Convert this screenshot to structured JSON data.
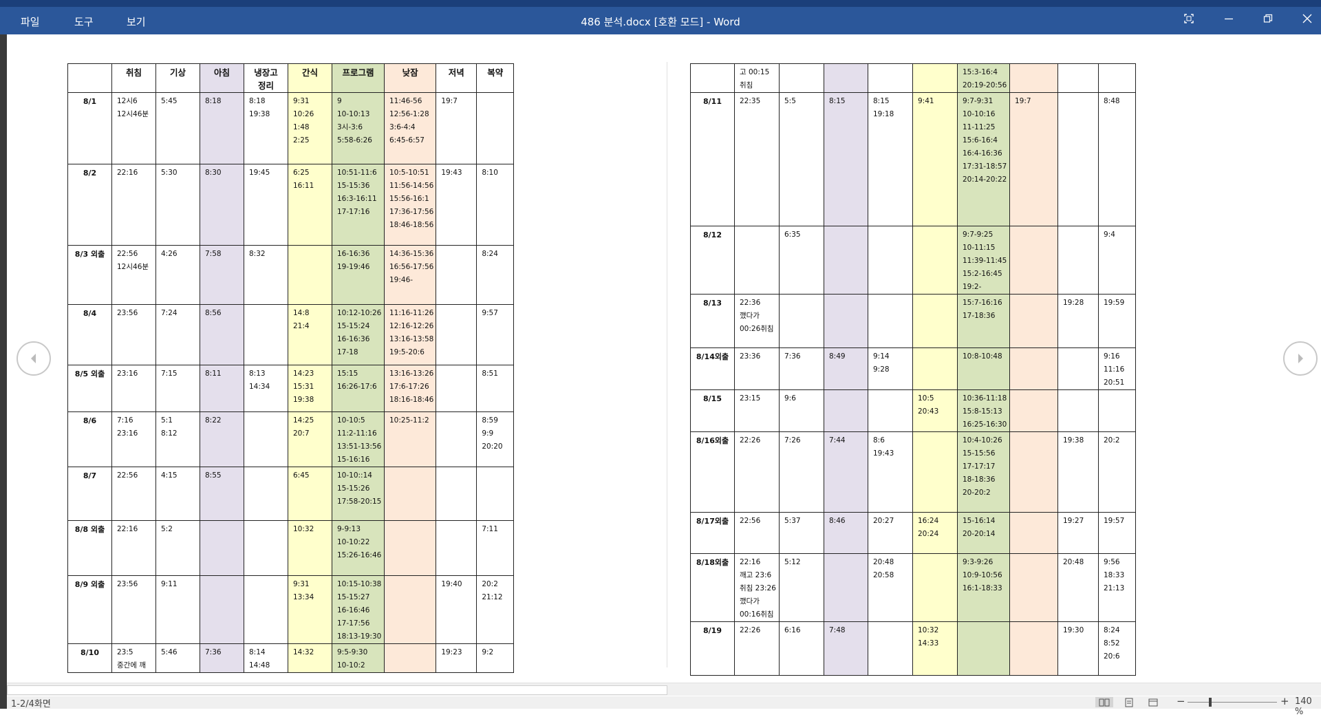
{
  "window": {
    "title": "486 분석.docx [호환 모드] - Word",
    "menus": [
      "파일",
      "도구",
      "보기"
    ]
  },
  "table": {
    "headers": [
      "",
      "취침",
      "기상",
      "아침",
      "냉장고\n정리",
      "간식",
      "프로그램",
      "낮잠",
      "저녁",
      "복약"
    ],
    "page1": [
      {
        "date": "8/1",
        "cells": [
          "12시6\n12시46분",
          "5:45",
          "8:18",
          "8:18\n19:38",
          "9:31\n10:26\n1:48\n2:25",
          "9\n10-10:13\n3시-3:6\n5:58-6:26",
          "11:46-56\n12:56-1:28\n3:6-4:4\n6:45-6:57",
          "19:7",
          ""
        ]
      },
      {
        "date": "8/2",
        "cells": [
          "22:16",
          "5:30",
          "8:30",
          "19:45",
          "6:25\n16:11",
          "10:51-11:6\n15-15:36\n16:3-16:11\n17-17:16",
          "10:5-10:51\n11:56-14:56\n15:56-16:1\n17:36-17:56\n18:46-18:56",
          "19:43",
          "8:10"
        ]
      },
      {
        "date": "8/3 외출",
        "cells": [
          "22:56\n12시46분",
          "4:26",
          "7:58",
          "8:32",
          "",
          "16-16:36\n19-19:46",
          "14:36-15:36\n16:56-17:56\n19:46-",
          "",
          "8:24"
        ]
      },
      {
        "date": "8/4",
        "cells": [
          "23:56",
          "7:24",
          "8:56",
          "",
          "14:8\n21:4",
          "10:12-10:26\n15-15:24\n16-16:36\n17-18",
          "11:16-11:26\n12:16-12:26\n13:16-13:58\n19:5-20:6",
          "",
          "9:57"
        ]
      },
      {
        "date": "8/5 외출",
        "cells": [
          "23:16",
          "7:15",
          "8:11",
          "8:13\n14:34",
          "14:23\n15:31\n19:38",
          "15:15\n16:26-17:6",
          "13:16-13:26\n17:6-17:26\n18:16-18:46",
          "",
          "8:51"
        ]
      },
      {
        "date": "8/6",
        "cells": [
          "7:16\n23:16",
          "5:1\n8:12",
          "8:22",
          "",
          "14:25\n20:7",
          "10-10:5\n11:2-11:16\n13:51-13:56\n15-16:16",
          "10:25-11:2",
          "",
          "8:59\n9:9\n20:20"
        ]
      },
      {
        "date": "8/7",
        "cells": [
          "22:56",
          "4:15",
          "8:55",
          "",
          "6:45",
          "10-10::14\n15-15:26\n17:58-20:15",
          "",
          "",
          ""
        ]
      },
      {
        "date": "8/8 외출",
        "cells": [
          "22:16",
          "5:2",
          "",
          "",
          "10:32",
          "9-9:13\n10-10:22\n15:26-16:46",
          "",
          "",
          "7:11"
        ]
      },
      {
        "date": "8/9 외출",
        "cells": [
          "23:56",
          "9:11",
          "",
          "",
          "9:31\n13:34",
          "10:15-10:38\n15-15:27\n16-16:46\n17-17:56\n18:13-19:30",
          "",
          "19:40",
          "20:2\n21:12"
        ]
      },
      {
        "date": "8/10",
        "cells": [
          "23:5\n중간에  깨",
          "5:46",
          "7:36",
          "8:14\n14:48",
          "14:32",
          "9:5-9:30\n10-10:2",
          "",
          "19:23",
          "9:2"
        ]
      }
    ],
    "page2": [
      {
        "date": "",
        "cells": [
          "고    00:15\n취침",
          "",
          "",
          "",
          "",
          "15:3-16:4\n20:19-20:56",
          "",
          "",
          ""
        ]
      },
      {
        "date": "8/11",
        "cells": [
          "22:35",
          "5:5",
          "8:15",
          "8:15\n19:18",
          "9:41",
          "9:7-9:31\n10-10:16\n11-11:25\n15:6-16:4\n16:4-16:36\n17:31-18:57\n20:14-20:22",
          "19:7",
          "",
          "8:48"
        ]
      },
      {
        "date": "8/12",
        "cells": [
          "",
          "6:35",
          "",
          "",
          "",
          "9:7-9:25\n10-11:15\n11:39-11:45\n15:2-16:45\n19:2-",
          "",
          "",
          "9:4"
        ]
      },
      {
        "date": "8/13",
        "cells": [
          "22:36\n깼다가\n00:26취침",
          "",
          "",
          "",
          "",
          "15:7-16:16\n17-18:36",
          "",
          "19:28",
          "19:59"
        ]
      },
      {
        "date": "8/14외출",
        "cells": [
          "23:36",
          "7:36",
          "8:49",
          "9:14\n9:28",
          "",
          "10:8-10:48",
          "",
          "",
          "9:16\n11:16\n20:51"
        ]
      },
      {
        "date": "8/15",
        "cells": [
          "23:15",
          "9:6",
          "",
          "",
          "10:5\n20:43",
          "10:36-11:18\n15:8-15:13\n16:25-16:30",
          "",
          "",
          ""
        ]
      },
      {
        "date": "8/16외출",
        "cells": [
          "22:26",
          "7:26",
          "7:44",
          "8:6\n19:43",
          "",
          "10:4-10:26\n15-15:56\n17-17:17\n18-18:36\n20-20:2",
          "",
          "19:38",
          "20:2"
        ]
      },
      {
        "date": "8/17외출",
        "cells": [
          "22:56",
          "5:37",
          "8:46",
          "20:27",
          "16:24\n20:24",
          "15-16:14\n20-20:14",
          "",
          "19:27",
          "19:57"
        ]
      },
      {
        "date": "8/18외출",
        "cells": [
          "22:16\n깨고    23:6\n취침  23:26\n깼다가\n00:16취침",
          "5:12",
          "",
          "20:48\n20:58",
          "",
          "9:3-9:26\n10:9-10:56\n16:1-18:33",
          "",
          "20:48",
          "9:56\n18:33\n21:13"
        ]
      },
      {
        "date": "8/19",
        "cells": [
          "22:26",
          "6:16",
          "7:48",
          "",
          "10:32\n14:33",
          "",
          "",
          "19:30",
          "8:24\n8:52\n20:6"
        ]
      }
    ]
  },
  "statusbar": {
    "page_info": "1-2/4화면",
    "zoom": "140 %"
  },
  "icons": {
    "nav_prev": "chevron-left-icon",
    "nav_next": "chevron-right-icon"
  }
}
